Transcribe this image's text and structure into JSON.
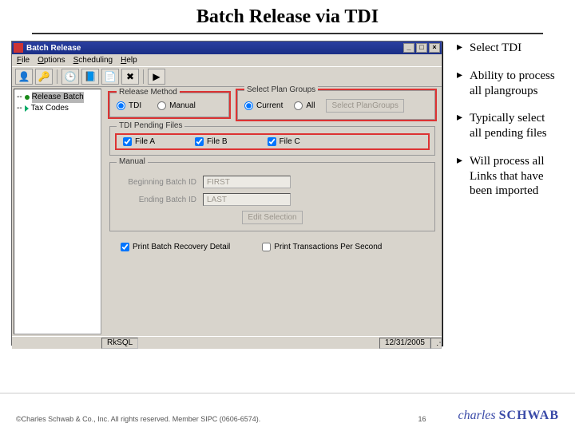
{
  "slide": {
    "title": "Batch Release via TDI",
    "page_number": "16",
    "copyright": "©Charles Schwab & Co., Inc. All rights reserved. Member SIPC (0606-6574).",
    "brand_a": "charles",
    "brand_b": "SCHWAB"
  },
  "bullets": [
    "Select TDI",
    "Ability to process all plangroups",
    "Typically select all pending files",
    "Will process all Links that have been imported"
  ],
  "app": {
    "title": "Batch Release",
    "menu": {
      "file": "File",
      "options": "Options",
      "scheduling": "Scheduling",
      "help": "Help"
    },
    "tree": {
      "node1": "Release Batch",
      "node2": "Tax Codes"
    },
    "groups": {
      "release_method": "Release Method",
      "plan_groups": "Select Plan Groups",
      "pending": "TDI Pending Files",
      "manual": "Manual"
    },
    "radios": {
      "tdi": "TDI",
      "manual": "Manual",
      "current": "Current",
      "all": "All"
    },
    "buttons": {
      "select_plan": "Select PlanGroups",
      "edit_selection": "Edit Selection"
    },
    "files": {
      "a": "File A",
      "b": "File B",
      "c": "File C"
    },
    "manual_form": {
      "begin_label": "Beginning Batch ID",
      "begin_value": "FIRST",
      "end_label": "Ending Batch ID",
      "end_value": "LAST"
    },
    "checks": {
      "detail": "Print Batch Recovery Detail",
      "tps": "Print Transactions Per Second"
    },
    "status": {
      "host": "RkSQL",
      "date": "12/31/2005"
    }
  }
}
